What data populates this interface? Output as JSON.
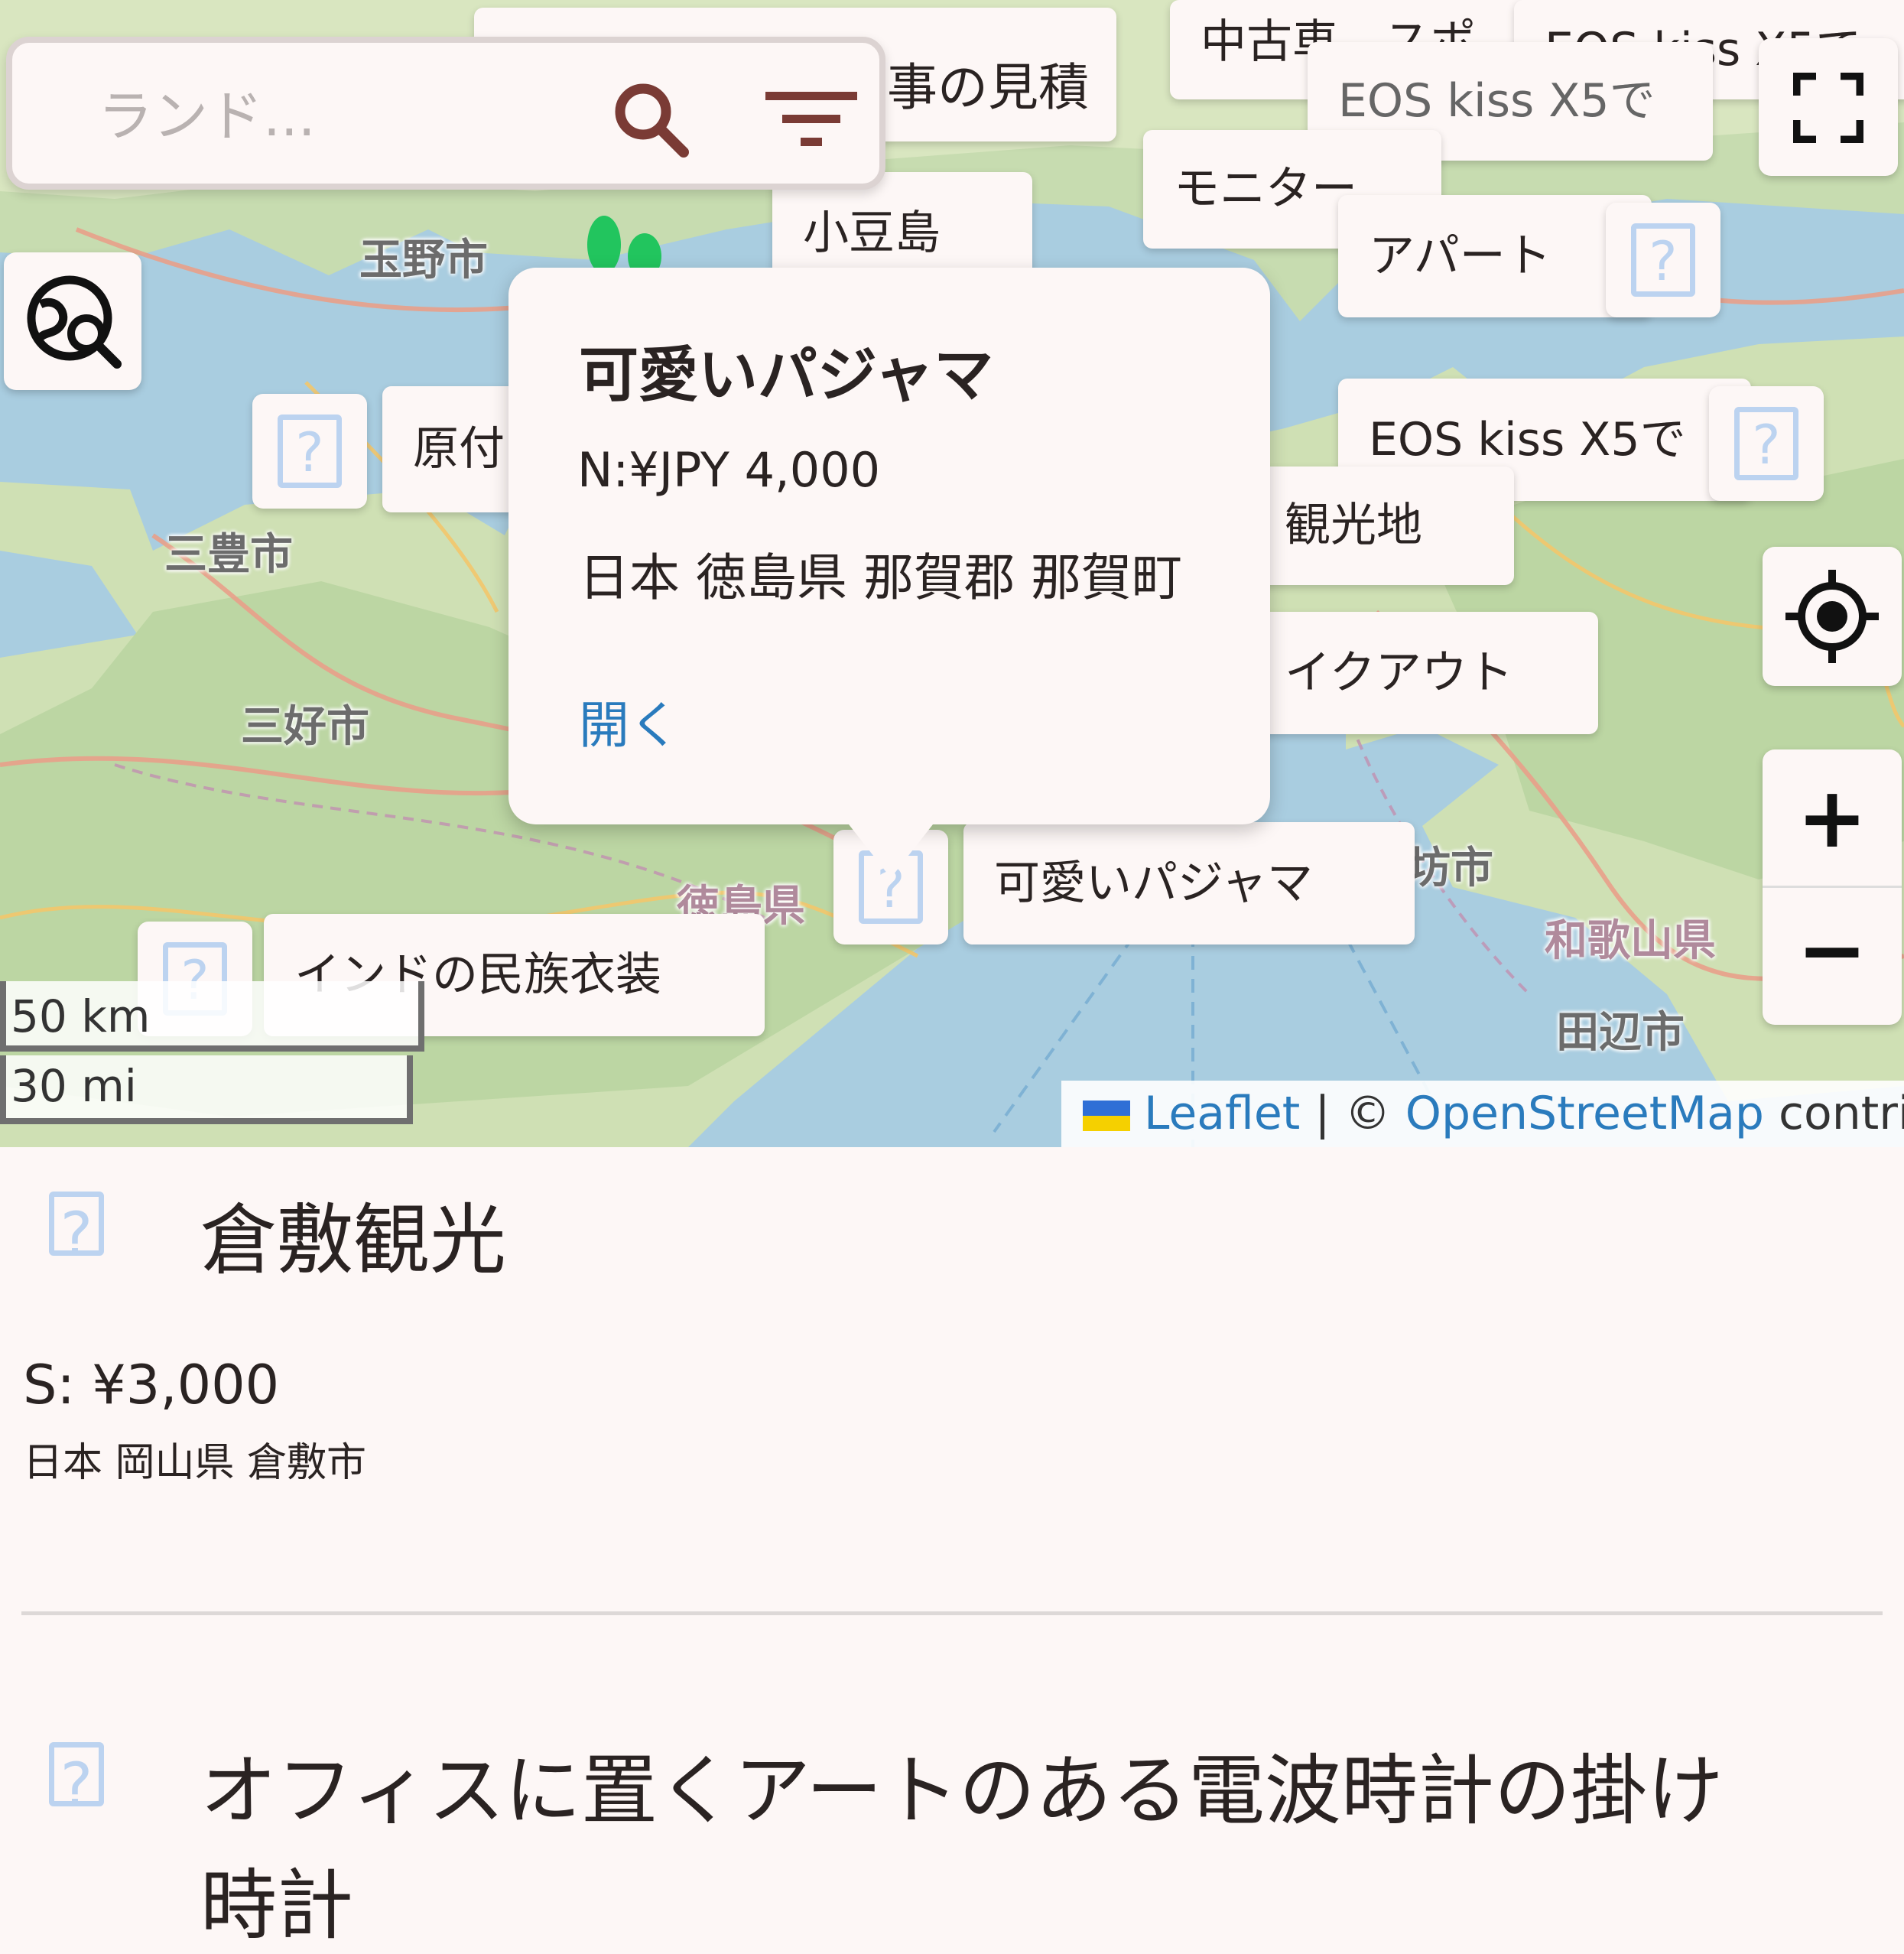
{
  "search": {
    "placeholder": "ランド..."
  },
  "map": {
    "place_labels": [
      "玉野市",
      "三豊市",
      "三好市",
      "徳島県",
      "御坊市",
      "和歌山県",
      "田辺市"
    ],
    "marker_labels": [
      "事の見積",
      "中古車、スポ",
      "EOS kiss X5で",
      "EOS kiss X5で",
      "モニター",
      "小豆島",
      "アパート",
      "原付",
      "EOS kiss X5で",
      "観光地",
      "イクアウト",
      "可愛いパジャマ",
      "インドの民族衣装"
    ],
    "popup": {
      "title": "可愛いパジャマ",
      "price": "N:¥JPY 4,000",
      "address": "日本 徳島県 那賀郡 那賀町",
      "open_link": "開く"
    },
    "scale": {
      "metric": "50 km",
      "imperial": "30 mi"
    },
    "attribution": {
      "leaflet": "Leaflet",
      "separator": "|",
      "copyright": "©",
      "osm": "OpenStreetMap",
      "contributors": "contributors"
    },
    "zoom_in": "+",
    "zoom_out": "−"
  },
  "listings": [
    {
      "title": "倉敷観光",
      "price": "S: ¥3,000",
      "address": "日本 岡山県 倉敷市"
    },
    {
      "title": "オフィスに置くアートのある電波時計の掛け",
      "title_line2": "時計"
    }
  ],
  "colors": {
    "background": "#fdf7f6",
    "accent_brown": "#7a3b35",
    "link_blue": "#2a7bbd",
    "placeholder_icon": "#bcd3f0"
  },
  "icons": [
    "search-icon",
    "filter-icon",
    "fullscreen-icon",
    "map-search-icon",
    "locate-icon",
    "image-placeholder-icon",
    "ukraine-flag-icon"
  ]
}
